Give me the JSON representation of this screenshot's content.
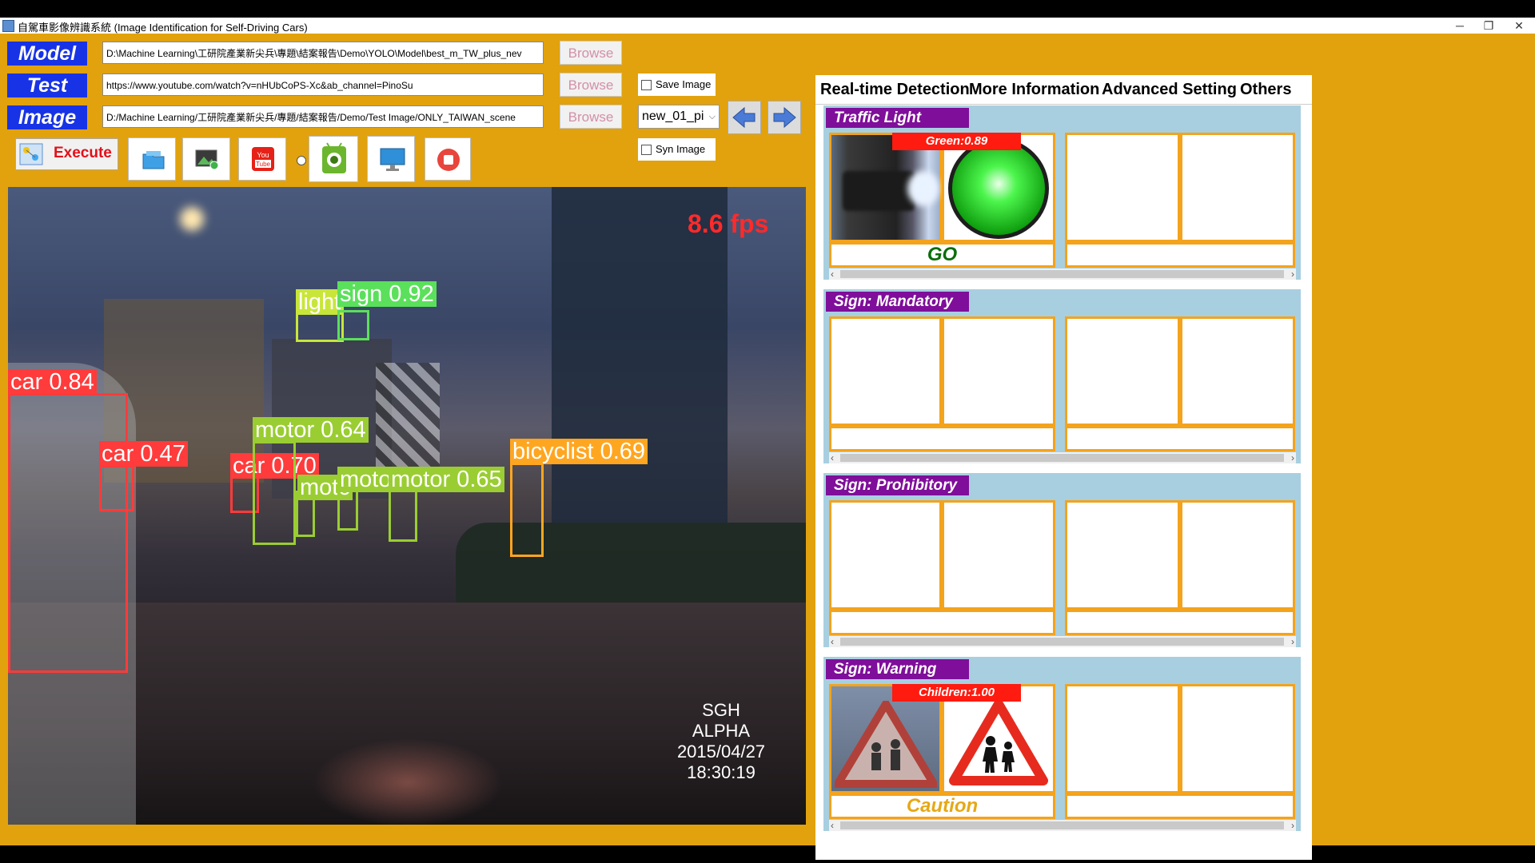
{
  "window": {
    "title": "自駕車影像辨識系統 (Image Identification for Self-Driving Cars)",
    "minimize": "─",
    "restore": "❐",
    "close": "✕"
  },
  "inputs": {
    "model": {
      "label": "Model",
      "path": "D:\\Machine Learning\\工研院產業新尖兵\\專題\\結案報告\\Demo\\YOLO\\Model\\best_m_TW_plus_nev",
      "browse": "Browse"
    },
    "test": {
      "label": "Test",
      "path": "https://www.youtube.com/watch?v=nHUbCoPS-Xc&ab_channel=PinoSu",
      "browse": "Browse"
    },
    "image": {
      "label": "Image",
      "path": "D:/Machine Learning/工研院產業新尖兵/專題/結案報告/Demo/Test Image/ONLY_TAIWAN_scene",
      "browse": "Browse"
    }
  },
  "options": {
    "save_image": "Save Image",
    "syn_image": "Syn Image",
    "image_select": "new_01_pi"
  },
  "toolbar": {
    "execute": "Execute",
    "source_selected": "youtube"
  },
  "video": {
    "fps": "8.6 fps",
    "camera_name": "SGH ALPHA",
    "camera_date": "2015/04/27",
    "camera_time": "18:30:19",
    "detections": [
      {
        "label": "car 0.84",
        "color": "#FF3B3B"
      },
      {
        "label": "car 0.47",
        "color": "#FF3B3B"
      },
      {
        "label": "car 0.70",
        "color": "#FF3B3B"
      },
      {
        "label": "light",
        "color": "#C8E63A"
      },
      {
        "label": "sign 0.92",
        "color": "#5BE05B"
      },
      {
        "label": "motor 0.64",
        "color": "#9ACD32"
      },
      {
        "label": "motc",
        "color": "#9ACD32"
      },
      {
        "label": "moto",
        "color": "#9ACD32"
      },
      {
        "label": "motor 0.65",
        "color": "#9ACD32"
      },
      {
        "label": "bicyclist 0.69",
        "color": "#FFA621"
      }
    ]
  },
  "tabs": [
    "Real-time Detection",
    "More Information",
    "Advanced Setting",
    "Others"
  ],
  "panels": {
    "traffic_light": {
      "title": "Traffic Light",
      "confidence": "Green:0.89",
      "status": "GO",
      "status_color": "#0B6E0B"
    },
    "mandatory": {
      "title": "Sign: Mandatory"
    },
    "prohibitory": {
      "title": "Sign: Prohibitory"
    },
    "warning": {
      "title": "Sign: Warning",
      "confidence": "Children:1.00",
      "status": "Caution",
      "status_color": "#E6A817"
    }
  },
  "colors": {
    "background": "#E1A20E",
    "label_bg": "#1833E6",
    "group_header": "#7F0E9A",
    "cell_border": "#F3A31C"
  }
}
